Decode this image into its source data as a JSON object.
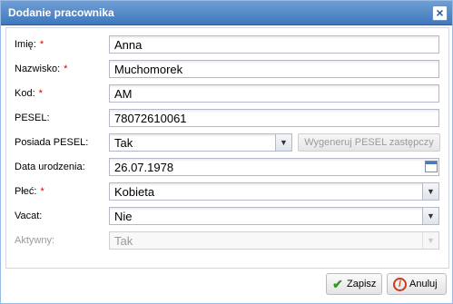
{
  "window": {
    "title": "Dodanie pracownika",
    "close_icon": "close-icon"
  },
  "form": {
    "imie": {
      "label": "Imię:",
      "required_mark": "*",
      "value": "Anna"
    },
    "nazwisko": {
      "label": "Nazwisko:",
      "required_mark": "*",
      "value": "Muchomorek"
    },
    "kod": {
      "label": "Kod:",
      "required_mark": "*",
      "value": "AM"
    },
    "pesel": {
      "label": "PESEL:",
      "value": "78072610061"
    },
    "posiada_pesel": {
      "label": "Posiada PESEL:",
      "value": "Tak",
      "generate_button": "Wygeneruj PESEL zastępczy"
    },
    "data_urodzenia": {
      "label": "Data urodzenia:",
      "value": "26.07.1978"
    },
    "plec": {
      "label": "Płeć:",
      "required_mark": "*",
      "value": "Kobieta"
    },
    "vacat": {
      "label": "Vacat:",
      "value": "Nie"
    },
    "aktywny": {
      "label": "Aktywny:",
      "value": "Tak"
    }
  },
  "buttons": {
    "save": "Zapisz",
    "cancel": "Anuluj"
  },
  "colors": {
    "titlebar": "#4a82c4",
    "required": "#d40000",
    "border": "#99bbe8"
  }
}
